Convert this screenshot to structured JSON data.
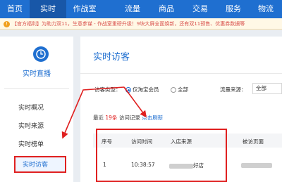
{
  "nav": {
    "items": [
      {
        "label": "首页"
      },
      {
        "label": "实时"
      },
      {
        "label": "作战室"
      },
      {
        "label": "流量"
      },
      {
        "label": "商品"
      },
      {
        "label": "交易"
      },
      {
        "label": "服务"
      },
      {
        "label": "物流"
      }
    ],
    "active": "实时",
    "color": "#1f6fd0"
  },
  "notice": {
    "text": "【官方福利】为助力双11，生意参谋 - 作战室重磅升级！9块大屏全面焕新，还有双11预售、优惠券数据等"
  },
  "sidebar": {
    "title": "实时直播",
    "icon": "clock-icon",
    "items": [
      {
        "label": "实时概况"
      },
      {
        "label": "实时来源"
      },
      {
        "label": "实时榜单"
      },
      {
        "label": "实时访客"
      }
    ],
    "active": "实时访客"
  },
  "main": {
    "title": "实时访客",
    "filter": {
      "visitor_type_label": "访客类型：",
      "options": [
        {
          "label": "仅淘宝会员",
          "selected": true
        },
        {
          "label": "全部",
          "selected": false
        }
      ],
      "source_label": "流量来源：",
      "source_value": "全部"
    },
    "recent": {
      "prefix": "最近",
      "count": "19条",
      "suffix": "访问记录",
      "refresh": "点击刷新"
    },
    "table": {
      "headers": [
        "序号",
        "访问时间",
        "入店来源",
        "被访页面"
      ],
      "rows": [
        {
          "index": "1",
          "time": "10:38:57",
          "source_suffix": "好店"
        }
      ]
    }
  }
}
